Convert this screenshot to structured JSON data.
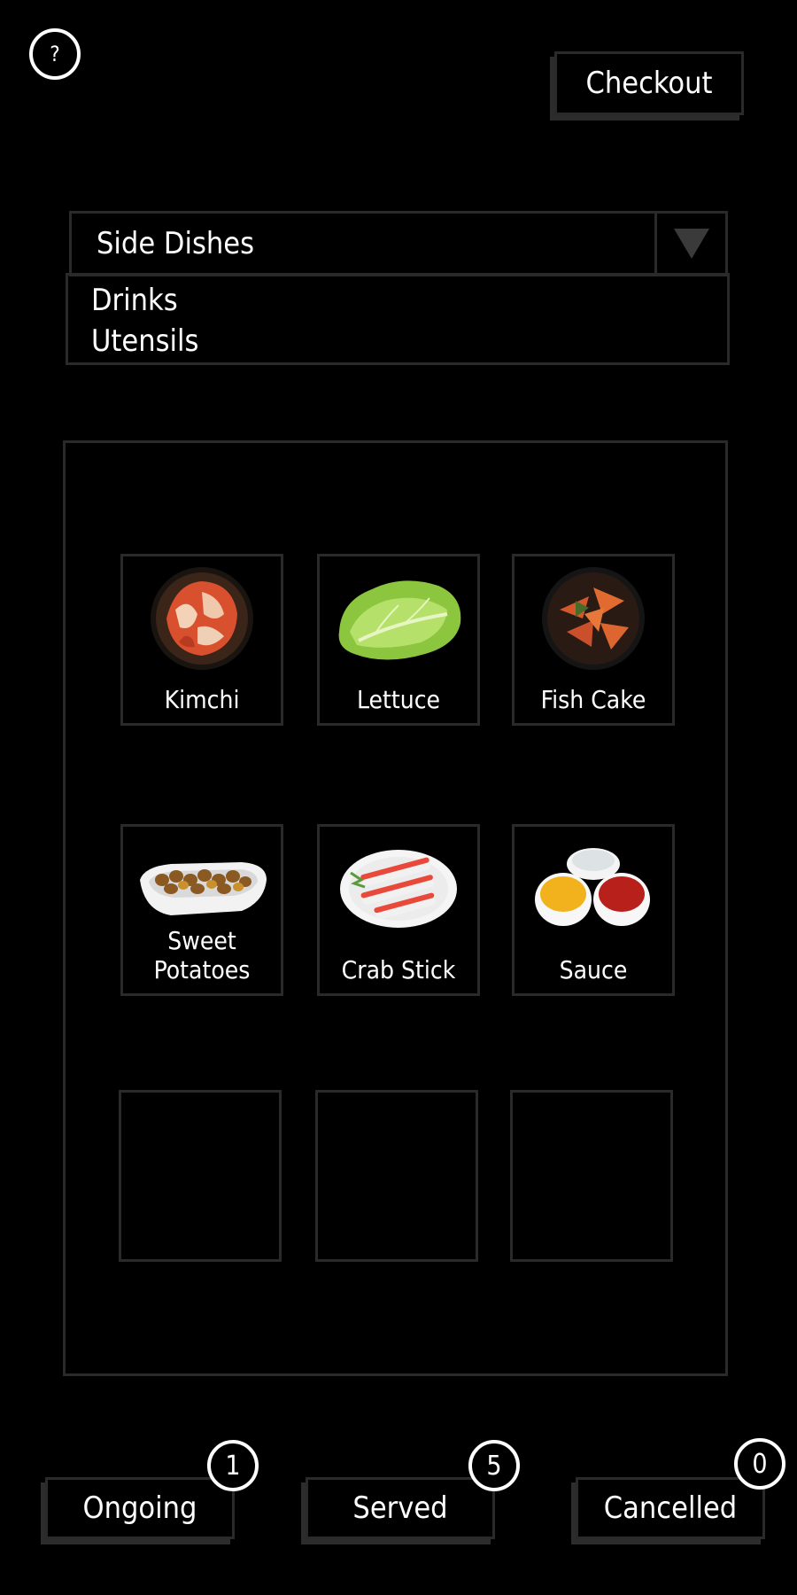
{
  "header": {
    "help_label": "?",
    "checkout_label": "Checkout"
  },
  "category_select": {
    "selected": "Side Dishes",
    "options": [
      "Drinks",
      "Utensils"
    ]
  },
  "menu": {
    "items": [
      {
        "label": "Kimchi",
        "icon": "kimchi-icon"
      },
      {
        "label": "Lettuce",
        "icon": "lettuce-icon"
      },
      {
        "label": "Fish Cake",
        "icon": "fish-cake-icon"
      },
      {
        "label": "Sweet Potatoes",
        "icon": "sweet-potatoes-icon"
      },
      {
        "label": "Crab Stick",
        "icon": "crab-stick-icon"
      },
      {
        "label": "Sauce",
        "icon": "sauce-icon"
      }
    ]
  },
  "footer": {
    "tabs": [
      {
        "label": "Ongoing",
        "count": "1"
      },
      {
        "label": "Served",
        "count": "5"
      },
      {
        "label": "Cancelled",
        "count": "0"
      }
    ]
  },
  "colors": {
    "background": "#000000",
    "border": "#2a2a2a",
    "text": "#ffffff"
  }
}
